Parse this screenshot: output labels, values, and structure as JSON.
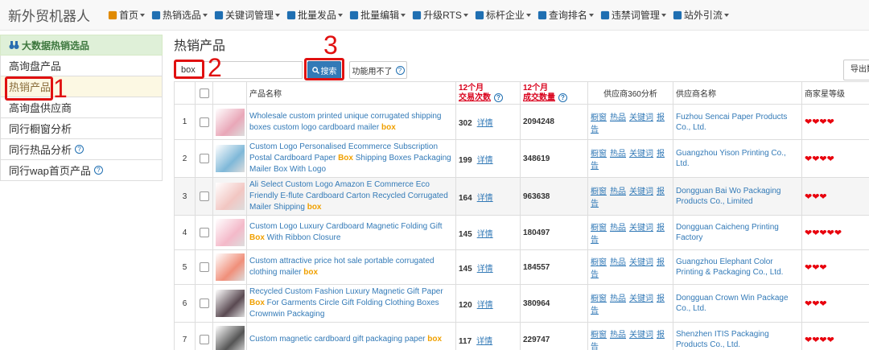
{
  "brand": "新外贸机器人",
  "nav": [
    {
      "label": "首页",
      "icon": "home-icon",
      "color": "#e08a00"
    },
    {
      "label": "热销选品",
      "icon": "hot-icon",
      "color": "#1f6fb2"
    },
    {
      "label": "关键词管理",
      "icon": "keyword-icon",
      "color": "#1f6fb2"
    },
    {
      "label": "批量发品",
      "icon": "edit-icon",
      "color": "#1f6fb2"
    },
    {
      "label": "批量编辑",
      "icon": "batch-edit-icon",
      "color": "#1f6fb2"
    },
    {
      "label": "升级RTS",
      "icon": "upgrade-icon",
      "color": "#1f6fb2"
    },
    {
      "label": "标杆企业",
      "icon": "thumbs-up-icon",
      "color": "#1f6fb2"
    },
    {
      "label": "查询排名",
      "icon": "trophy-icon",
      "color": "#1f6fb2"
    },
    {
      "label": "违禁词管理",
      "icon": "ban-icon",
      "color": "#1f6fb2"
    },
    {
      "label": "站外引流",
      "icon": "upload-icon",
      "color": "#1f6fb2"
    }
  ],
  "sidebar": {
    "header": "大数据热销选品",
    "items": [
      {
        "label": "高询盘产品",
        "active": false,
        "help": false
      },
      {
        "label": "热销产品",
        "active": true,
        "help": false
      },
      {
        "label": "高询盘供应商",
        "active": false,
        "help": false
      },
      {
        "label": "同行橱窗分析",
        "active": false,
        "help": false
      },
      {
        "label": "同行热品分析",
        "active": false,
        "help": true
      },
      {
        "label": "同行wap首页产品",
        "active": false,
        "help": true
      }
    ]
  },
  "main": {
    "title": "热销产品",
    "search_value": "box",
    "search_label": "搜索",
    "unuse_label": "功能用不了",
    "export_label": "导出数据"
  },
  "table": {
    "headers": {
      "name": "产品名称",
      "trades_l1": "12个月",
      "trades_l2": "交易次数",
      "qty_l1": "12个月",
      "qty_l2": "成交数量",
      "analysis": "供应商360分析",
      "supplier": "供应商名称",
      "stars": "商家星等级"
    },
    "detail_label": "详情",
    "analysis_links": [
      "橱窗",
      "热品",
      "关键词",
      "报告"
    ],
    "rows": [
      {
        "idx": "1",
        "name_pre": "Wholesale custom printed unique corrugated shipping boxes custom logo cardboard mailer ",
        "kw": "box",
        "name_post": "",
        "trades": "302",
        "qty": "2094248",
        "supplier": "Fuzhou Sencai Paper Products Co., Ltd.",
        "stars": "❤❤❤❤",
        "thumb": "#e9a7b8"
      },
      {
        "idx": "2",
        "name_pre": "Custom Logo Personalised Ecommerce Subscription Postal Cardboard Paper ",
        "kw": "Box",
        "name_post": " Shipping Boxes Packaging Mailer Box With Logo",
        "trades": "199",
        "qty": "348619",
        "supplier": "Guangzhou Yison Printing Co., Ltd.",
        "stars": "❤❤❤❤",
        "thumb": "#7fb8d8"
      },
      {
        "idx": "3",
        "name_pre": "Ali Select Custom Logo Amazon E Commerce Eco Friendly E-flute Cardboard Carton Recycled Corrugated Mailer Shipping ",
        "kw": "box",
        "name_post": "",
        "trades": "164",
        "qty": "963638",
        "supplier": "Dongguan Bai Wo Packaging Products Co., Limited",
        "stars": "❤❤❤",
        "thumb": "#f2c6c2"
      },
      {
        "idx": "4",
        "name_pre": "Custom Logo Luxury Cardboard Magnetic Folding Gift ",
        "kw": "Box",
        "name_post": " With Ribbon Closure",
        "trades": "145",
        "qty": "180497",
        "supplier": "Dongguan Caicheng Printing Factory",
        "stars": "❤❤❤❤❤",
        "thumb": "#f4b9c9"
      },
      {
        "idx": "5",
        "name_pre": "Custom attractive price hot sale portable corrugated clothing mailer ",
        "kw": "box",
        "name_post": "",
        "trades": "145",
        "qty": "184557",
        "supplier": "Guangzhou Elephant Color Printing & Packaging Co., Ltd.",
        "stars": "❤❤❤",
        "thumb": "#f08f7a"
      },
      {
        "idx": "6",
        "name_pre": "Recycled Custom Fashion Luxury Magnetic Gift Paper ",
        "kw": "Box",
        "name_post": " For Garments Circle Gift Folding Clothing Boxes Crownwin Packaging",
        "trades": "120",
        "qty": "380964",
        "supplier": "Dongguan Crown Win Package Co., Ltd.",
        "stars": "❤❤❤",
        "thumb": "#5a4a52"
      },
      {
        "idx": "7",
        "name_pre": "Custom magnetic cardboard gift packaging paper ",
        "kw": "box",
        "name_post": "",
        "trades": "117",
        "qty": "229747",
        "supplier": "Shenzhen ITIS Packaging Products Co., Ltd.",
        "stars": "❤❤❤❤",
        "thumb": "#555555"
      }
    ]
  },
  "annotations": [
    "1",
    "2",
    "3"
  ]
}
